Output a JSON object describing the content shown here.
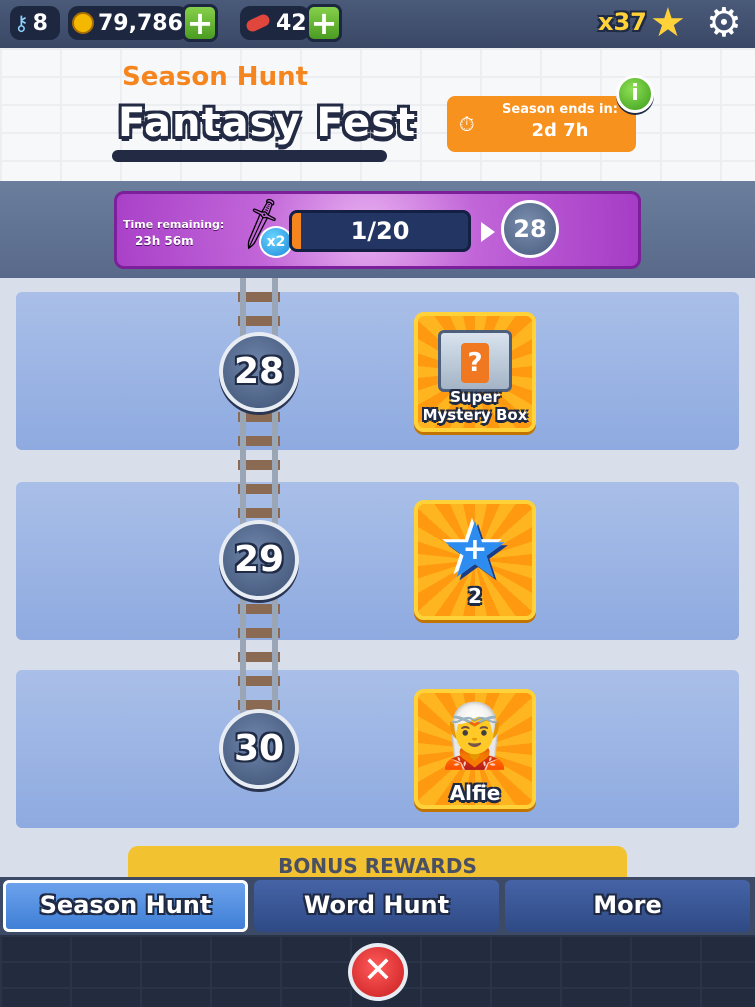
{
  "topbar": {
    "keys": "8",
    "coins": "79,786",
    "boards": "42",
    "stars": "x37",
    "plus": "+"
  },
  "header": {
    "subtitle": "Season Hunt",
    "title": "Fantasy Fest",
    "season_ends_label": "Season ends in:",
    "season_ends_value": "2d 7h",
    "info": "i"
  },
  "progress": {
    "time_remaining_label": "Time remaining:",
    "time_remaining_value": "23h 56m",
    "multiplier": "x2",
    "progress_text": "1/20",
    "progress_fraction": 0.05,
    "next_level": "28"
  },
  "rewards": [
    {
      "level": "28",
      "label": "Super Mystery Box",
      "icon": "mystery-box-icon"
    },
    {
      "level": "29",
      "label": "2",
      "icon": "star-booster-icon"
    },
    {
      "level": "30",
      "label": "Alfie",
      "icon": "character-icon"
    }
  ],
  "bonus_banner": "BONUS REWARDS",
  "tabs": [
    {
      "label": "Season Hunt",
      "active": true
    },
    {
      "label": "Word Hunt",
      "active": false
    },
    {
      "label": "More",
      "active": false
    }
  ],
  "close": "✕"
}
